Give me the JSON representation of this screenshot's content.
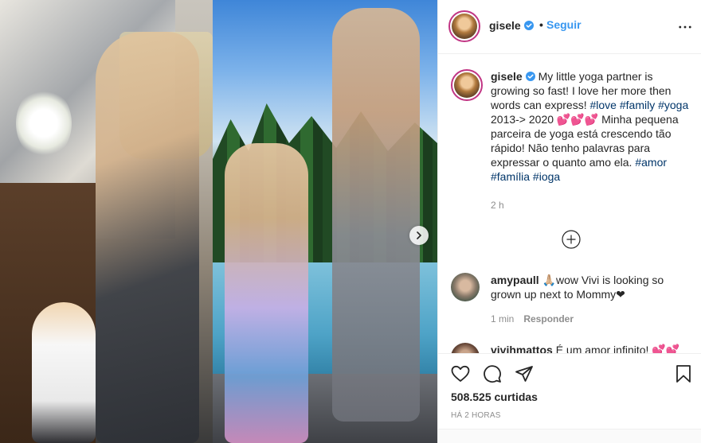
{
  "post": {
    "username": "gisele",
    "separator": "•",
    "follow_label": "Seguir",
    "caption": {
      "text_1": "My little yoga partner is growing so fast! I love her more then words can express!",
      "tags_1": [
        "#love",
        "#family",
        "#yoga"
      ],
      "text_2": "2013-> 2020 💕💕💕 Minha pequena parceira de yoga está crescendo tão rápido! Não tenho palavras para expressar o quanto amo ela.",
      "tags_2": [
        "#amor",
        "#família",
        "#ioga"
      ],
      "time": "2 h"
    },
    "comments": [
      {
        "username": "amypaull",
        "text": "🙏🏼wow Vivi is looking so grown up next to Mommy❤",
        "time": "1 min",
        "reply_label": "Responder"
      },
      {
        "username": "vivihmattos",
        "text": "É um amor infinito! 💕💕"
      }
    ],
    "likes": "508.525 curtidas",
    "posted": "HÁ 2 HORAS"
  },
  "colors": {
    "link": "#3897f0",
    "hashtag": "#003569",
    "story_ring": "#c13584",
    "verified": "#3897f0"
  },
  "icons": {
    "verified": "verified-badge-icon",
    "more": "more-options-icon",
    "next": "chevron-right-icon",
    "load_more": "plus-circle-icon",
    "like": "heart-icon",
    "comment": "comment-icon",
    "share": "paper-plane-icon",
    "save": "bookmark-icon"
  }
}
